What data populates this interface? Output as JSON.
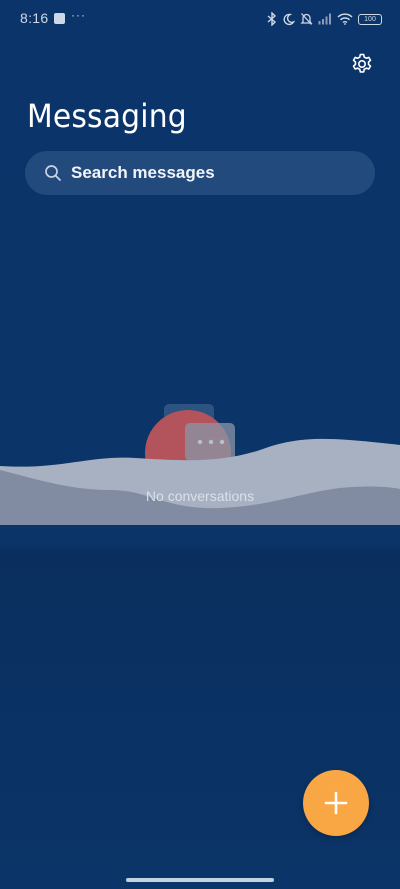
{
  "status_bar": {
    "time": "8:16",
    "overflow_dots": "···",
    "battery": "100"
  },
  "header": {
    "title": "Messaging",
    "settings_icon": "gear-icon"
  },
  "search": {
    "placeholder": "Search messages",
    "value": "",
    "icon": "search-icon"
  },
  "empty_state": {
    "text": "No conversations"
  },
  "fab": {
    "icon": "plus-icon",
    "color": "#f9a645"
  },
  "colors": {
    "background": "#0b3468",
    "search_background": "#234a7c",
    "accent": "#f9a645"
  }
}
